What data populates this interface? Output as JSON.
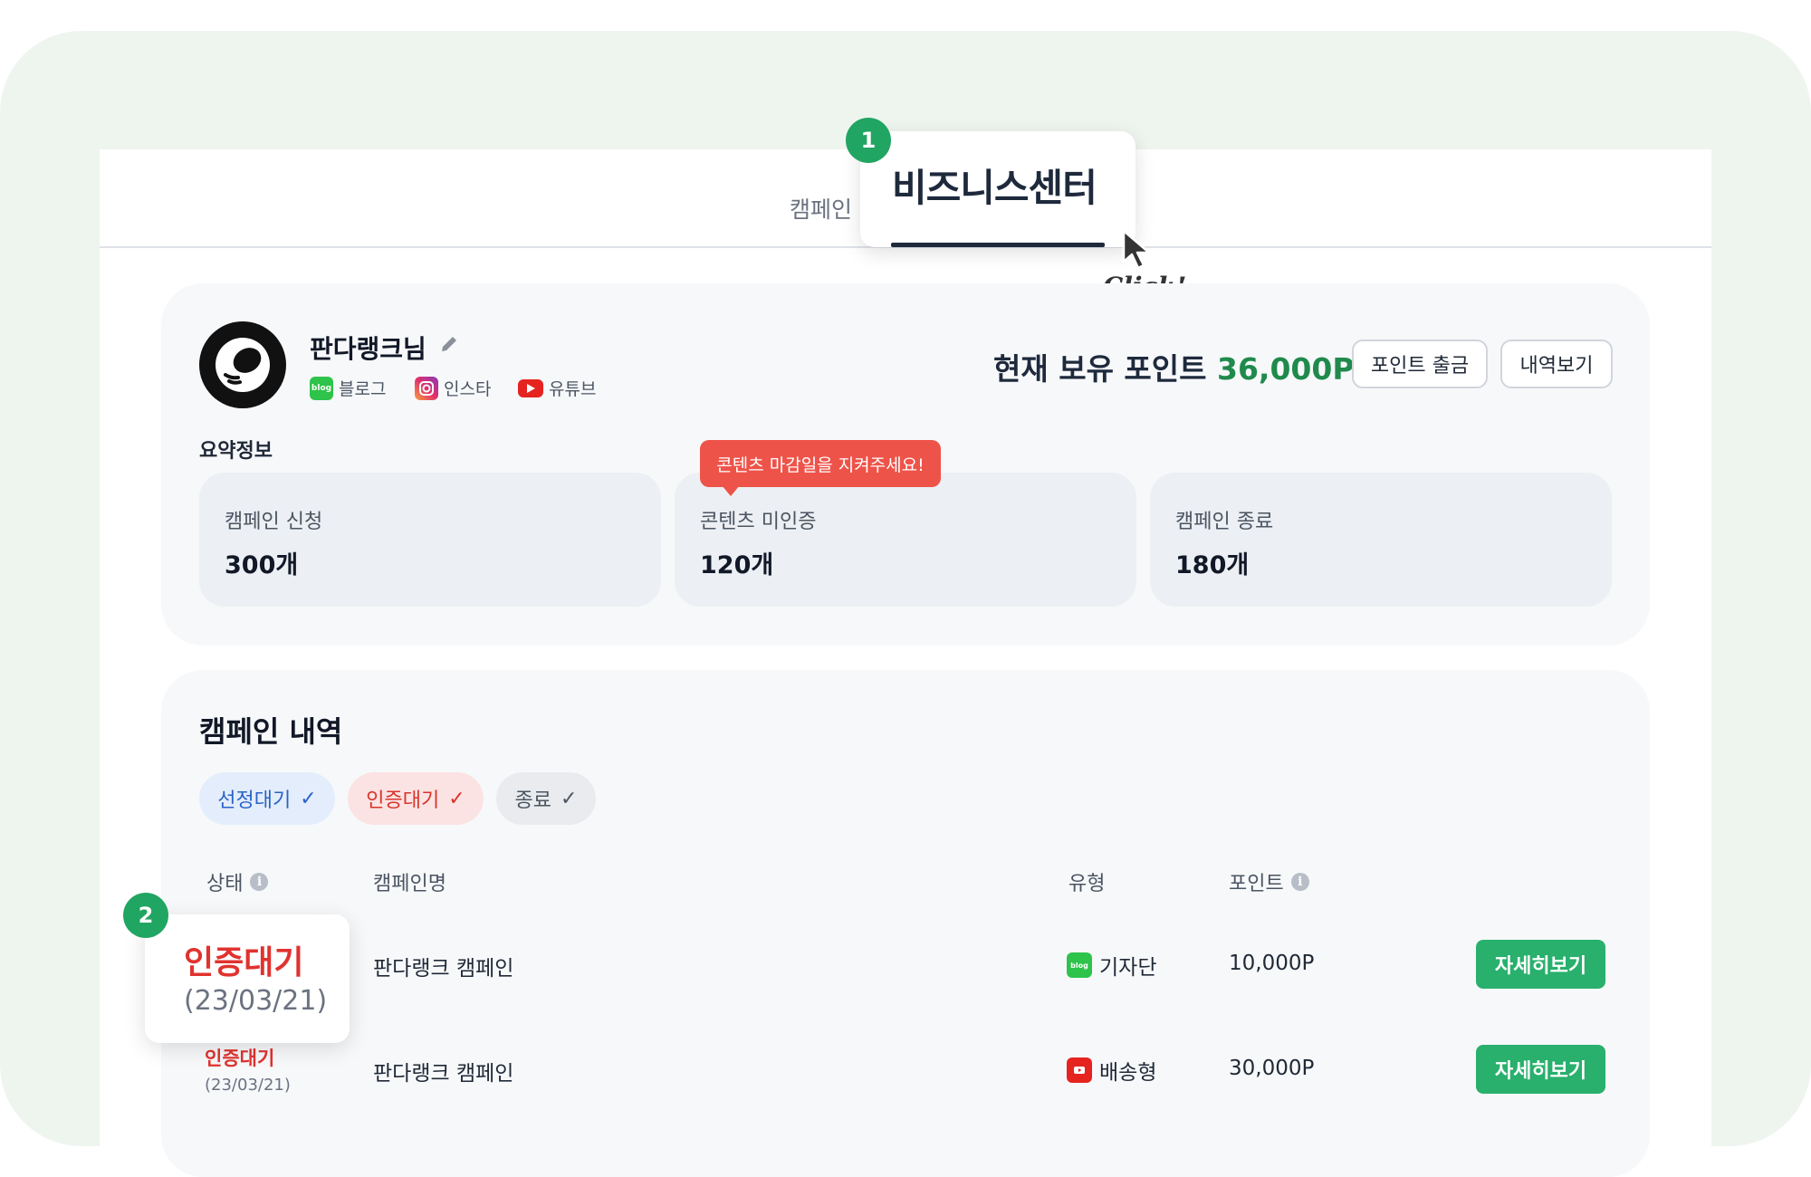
{
  "tabs": {
    "campaign": "캠페인",
    "business_center": "비즈니스센터"
  },
  "steps": {
    "one": "1",
    "two": "2"
  },
  "click_label": "Click!",
  "profile": {
    "name": "판다랭크님",
    "sns": [
      {
        "icon": "blog-icon",
        "badge": "blog",
        "label": "블로그",
        "color": "#2ec34a"
      },
      {
        "icon": "instagram-icon",
        "label": "인스타",
        "color": "#e1306c"
      },
      {
        "icon": "youtube-icon",
        "label": "유튜브",
        "color": "#e52420"
      }
    ]
  },
  "points": {
    "label": "현재 보유 포인트",
    "value": "36,000P",
    "withdraw_label": "포인트 출금",
    "history_label": "내역보기"
  },
  "summary": {
    "title": "요약정보",
    "tooltip": "콘텐츠 마감일을 지켜주세요!",
    "stats": [
      {
        "label": "캠페인 신청",
        "value": "300개"
      },
      {
        "label": "콘텐츠 미인증",
        "value": "120개"
      },
      {
        "label": "캠페인 종료",
        "value": "180개"
      }
    ]
  },
  "history": {
    "title": "캠페인 내역",
    "filters": [
      {
        "label": "선정대기",
        "check": "✓",
        "bg": "#e3edfc",
        "fg": "#2a63c6"
      },
      {
        "label": "인증대기",
        "check": "✓",
        "bg": "#fbe3e3",
        "fg": "#d9342b"
      },
      {
        "label": "종료",
        "check": "✓",
        "bg": "#e9ebee",
        "fg": "#4b5563"
      }
    ],
    "columns": {
      "status": "상태",
      "name": "캠페인명",
      "type": "유형",
      "points": "포인트"
    },
    "info_glyph": "i",
    "rows": [
      {
        "status": "인증대기",
        "date": "(23/03/21)",
        "name": "판다랭크 캠페인",
        "type": "기자단",
        "type_icon": "blog-icon",
        "type_badge": "blog",
        "points": "10,000P",
        "action": "자세히보기"
      },
      {
        "status": "인증대기",
        "date": "(23/03/21)",
        "name": "판다랭크 캠페인",
        "type": "배송형",
        "type_icon": "youtube-icon",
        "points": "30,000P",
        "action": "자세히보기"
      }
    ]
  },
  "colors": {
    "accent_green": "#21a562",
    "points_green": "#1f8a4c",
    "status_red": "#e0332f",
    "navy": "#1e2a3c"
  }
}
